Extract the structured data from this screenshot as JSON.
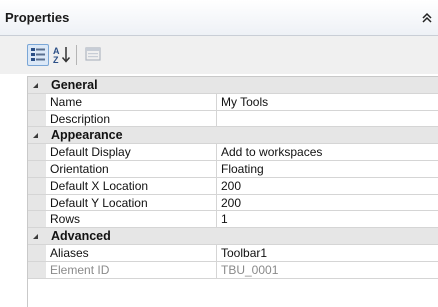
{
  "panel": {
    "title": "Properties",
    "collapse_icon": "double-chevron-up-icon"
  },
  "toolbar": {
    "buttons": [
      {
        "name": "categorized-view",
        "icon": "categorized-icon",
        "active": true
      },
      {
        "name": "alphabetical-sort",
        "icon": "sort-az-icon",
        "active": false
      },
      {
        "name": "property-pages",
        "icon": "property-pages-icon",
        "active": false,
        "disabled": true
      }
    ]
  },
  "grid": {
    "categories": [
      {
        "label": "General",
        "properties": [
          {
            "name": "Name",
            "value": "My Tools"
          },
          {
            "name": "Description",
            "value": ""
          }
        ]
      },
      {
        "label": "Appearance",
        "properties": [
          {
            "name": "Default Display",
            "value": "Add to workspaces"
          },
          {
            "name": "Orientation",
            "value": "Floating"
          },
          {
            "name": "Default X Location",
            "value": "200"
          },
          {
            "name": "Default Y Location",
            "value": "200"
          },
          {
            "name": "Rows",
            "value": "1"
          }
        ]
      },
      {
        "label": "Advanced",
        "properties": [
          {
            "name": "Aliases",
            "value": "Toolbar1"
          },
          {
            "name": "Element ID",
            "value": "TBU_0001",
            "readonly": true
          }
        ]
      }
    ]
  },
  "colors": {
    "category_background": "#e6e6e6",
    "active_button_fill": "#dbe8f7",
    "active_button_border": "#7aa6d6",
    "readonly_text": "#8a8a8a"
  }
}
